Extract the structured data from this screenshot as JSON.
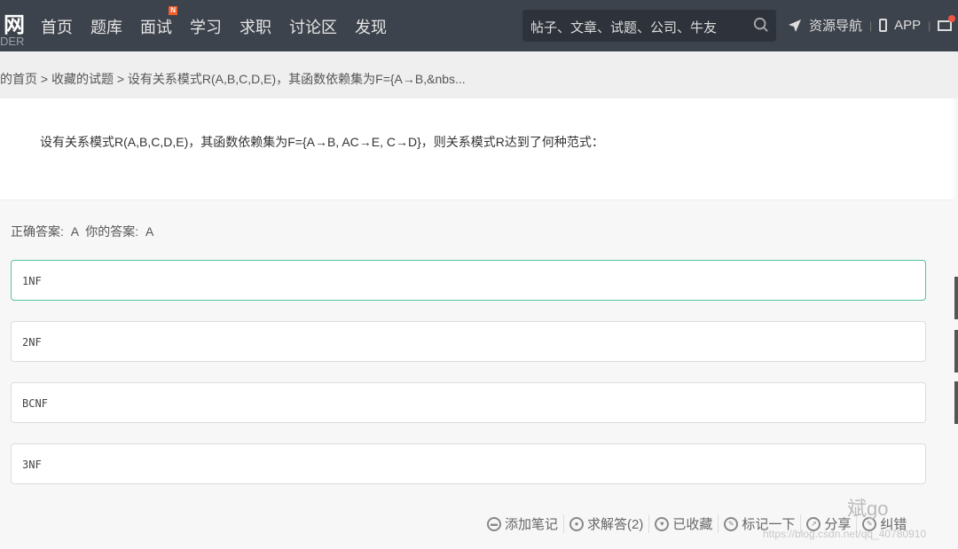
{
  "header": {
    "logo": "网",
    "logo_sub": "DER",
    "nav": [
      "首页",
      "题库",
      "面试",
      "学习",
      "求职",
      "讨论区",
      "发现"
    ],
    "nav_badge": "N",
    "search_placeholder": "帖子、文章、试题、公司、牛友",
    "resources": "资源导航",
    "app": "APP"
  },
  "breadcrumb": "的首页 > 收藏的试题 > 设有关系模式R(A,B,C,D,E)，其函数依赖集为F={A→B,&nbs...",
  "question": "设有关系模式R(A,B,C,D,E)，其函数依赖集为F={A→B, AC→E, C→D}，则关系模式R达到了何种范式：",
  "answer_line": "正确答案: A   你的答案: A",
  "options": [
    "1NF",
    "2NF",
    "BCNF",
    "3NF"
  ],
  "actions": [
    "添加笔记",
    "求解答(2)",
    "已收藏",
    "标记一下",
    "分享",
    "纠错"
  ],
  "watermark": "https://blog.csdn.net/qq_40780910",
  "watermark_brand": "斌go"
}
